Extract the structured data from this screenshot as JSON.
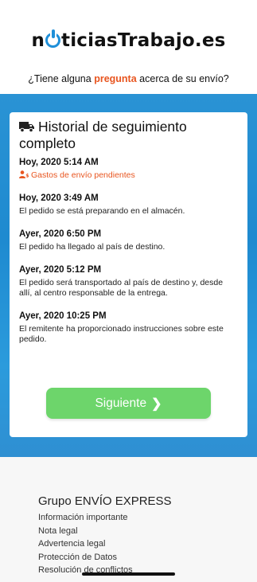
{
  "header": {
    "logo_prefix": "n",
    "logo_suffix": "ticiasTrabajo.es",
    "tagline_before": "¿Tiene alguna ",
    "tagline_highlight": "pregunta",
    "tagline_after": " acerca de su envío?"
  },
  "card": {
    "title": "Historial de seguimiento completo",
    "icon": "truck-icon",
    "events": [
      {
        "time": "Hoy, 2020 5:14 AM",
        "description": "Gastos de envío pendientes",
        "status": "warning",
        "icon": "user-dollar-icon"
      },
      {
        "time": "Hoy, 2020 3:49 AM",
        "description": "El pedido se está preparando en el almacén."
      },
      {
        "time": "Ayer, 2020 6:50 PM",
        "description": "El pedido ha llegado al país de destino."
      },
      {
        "time": "Ayer, 2020 5:12 PM",
        "description": "El pedido será transportado al país de destino y, desde allí, al centro responsable de la entrega."
      },
      {
        "time": "Ayer, 2020 10:25 PM",
        "description": "El remitente ha proporcionado instrucciones sobre este pedido."
      }
    ],
    "next_label": "Siguiente"
  },
  "footer": {
    "title": "Grupo ENVÍO EXPRESS",
    "links": [
      "Información importante",
      "Nota legal",
      "Advertencia legal",
      "Protección de Datos",
      "Resolución de conflictos"
    ]
  },
  "colors": {
    "accent_orange": "#e8551f",
    "band_blue": "#2a93d4",
    "button_green": "#6dd56b",
    "logo_blue": "#1f8fd8"
  }
}
